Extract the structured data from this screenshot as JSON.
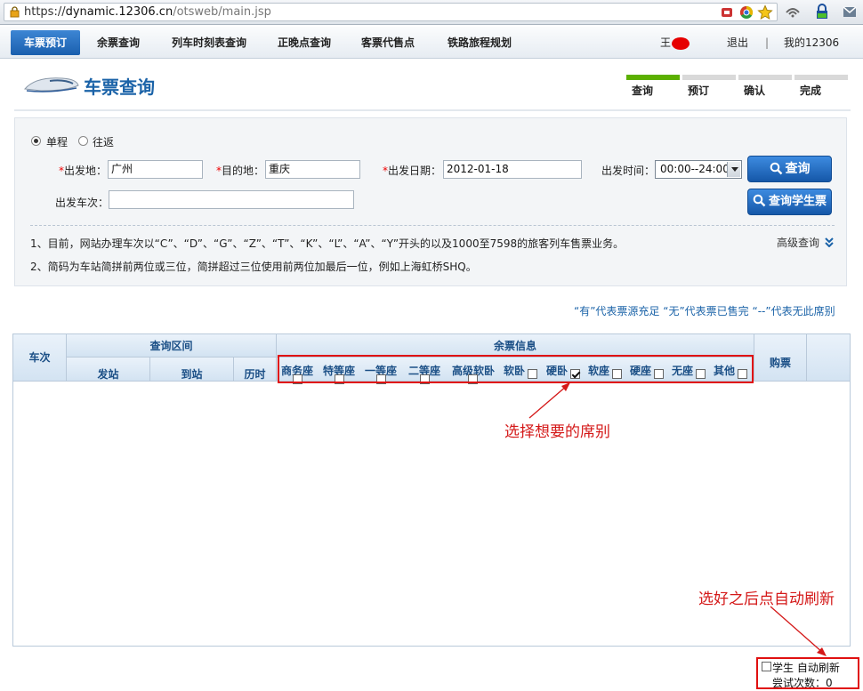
{
  "browser": {
    "url_scheme": "https://",
    "url_host": "dynamic.12306.cn",
    "url_path": "/otsweb/main.jsp"
  },
  "nav": {
    "items": [
      {
        "label": "车票预订",
        "active": true
      },
      {
        "label": "余票查询",
        "active": false
      },
      {
        "label": "列车时刻表查询",
        "active": false
      },
      {
        "label": "正晚点查询",
        "active": false
      },
      {
        "label": "客票代售点",
        "active": false
      },
      {
        "label": "铁路旅程规划",
        "active": false
      }
    ],
    "user_name": "王",
    "logout": "退出",
    "separator": "|",
    "my_account": "我的12306"
  },
  "header": {
    "title": "车票查询",
    "steps": [
      {
        "label": "查询",
        "active": true
      },
      {
        "label": "预订",
        "active": false
      },
      {
        "label": "确认",
        "active": false
      },
      {
        "label": "完成",
        "active": false
      }
    ]
  },
  "query": {
    "trip_one_way": "单程",
    "trip_round": "往返",
    "required_mark": "*",
    "from_label": "出发地：",
    "from_value": "广州",
    "to_label": "目的地：",
    "to_value": "重庆",
    "date_label": "出发日期：",
    "date_value": "2012-01-18",
    "time_label": "出发时间：",
    "time_value": "00:00--24:00",
    "train_label": "出发车次：",
    "train_value": "",
    "search_button": "查询",
    "student_button": "查询学生票",
    "note1": "1、目前，网站办理车次以“C”、“D”、“G”、“Z”、“T”、“K”、“L”、“A”、“Y”开头的以及1000至7598的旅客列车售票业务。",
    "note2": "2、简码为车站简拼前两位或三位，简拼超过三位使用前两位加最后一位，例如上海虹桥SHQ。",
    "advanced": "高级查询"
  },
  "legend_text": "“有”代表票源充足  “无”代表票已售完  “--”代表无此席别",
  "table": {
    "col_train": "车次",
    "group_interval": "查询区间",
    "col_from": "发站",
    "col_to": "到站",
    "col_duration": "历时",
    "group_seats": "余票信息",
    "col_buy": "购票",
    "seats": [
      {
        "label": "商务座",
        "checked": false
      },
      {
        "label": "特等座",
        "checked": false
      },
      {
        "label": "一等座",
        "checked": false
      },
      {
        "label": "二等座",
        "checked": false
      },
      {
        "label": "高级软卧",
        "checked": false
      },
      {
        "label": "软卧",
        "checked": false
      },
      {
        "label": "硬卧",
        "checked": true
      },
      {
        "label": "软座",
        "checked": false
      },
      {
        "label": "硬座",
        "checked": false
      },
      {
        "label": "无座",
        "checked": false
      },
      {
        "label": "其他",
        "checked": false
      }
    ]
  },
  "annotations": {
    "select_seat": "选择想要的席别",
    "auto_refresh_hint": "选好之后点自动刷新"
  },
  "bottom": {
    "auto_refresh": "学生 自动刷新",
    "attempts_label": "尝试次数：",
    "attempts_value": "0"
  },
  "colors": {
    "accent": "#1b63a8",
    "annotation_red": "#d41818",
    "step_active": "#5cb000"
  }
}
